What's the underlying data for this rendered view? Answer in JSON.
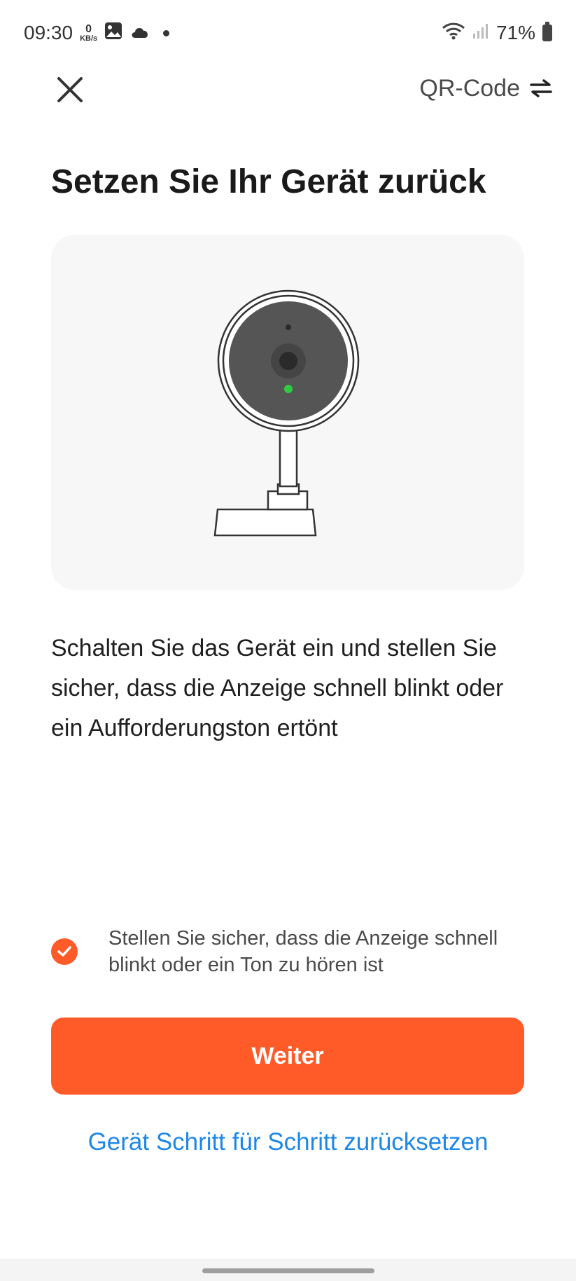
{
  "status_bar": {
    "time": "09:30",
    "net_speed_value": "0",
    "net_speed_unit": "KB/s",
    "battery": "71%"
  },
  "topbar": {
    "close_icon": "close-icon",
    "qr_label": "QR-Code",
    "qr_icon": "swap-arrows-icon"
  },
  "page": {
    "title": "Setzen Sie Ihr Gerät zurück",
    "illustration": "camera-device-illustration",
    "description": "Schalten Sie das Gerät ein und stellen Sie sicher, dass die Anzeige schnell blinkt oder ein Aufforderungston ertönt",
    "confirm": {
      "checked": true,
      "text": "Stellen Sie sicher, dass die Anzeige schnell blinkt oder ein Ton zu hören ist"
    },
    "primary_button": "Weiter",
    "link": "Gerät Schritt für Schritt zurücksetzen"
  },
  "colors": {
    "accent": "#fe5b29",
    "link": "#1e88e5",
    "led": "#2ecc40"
  }
}
